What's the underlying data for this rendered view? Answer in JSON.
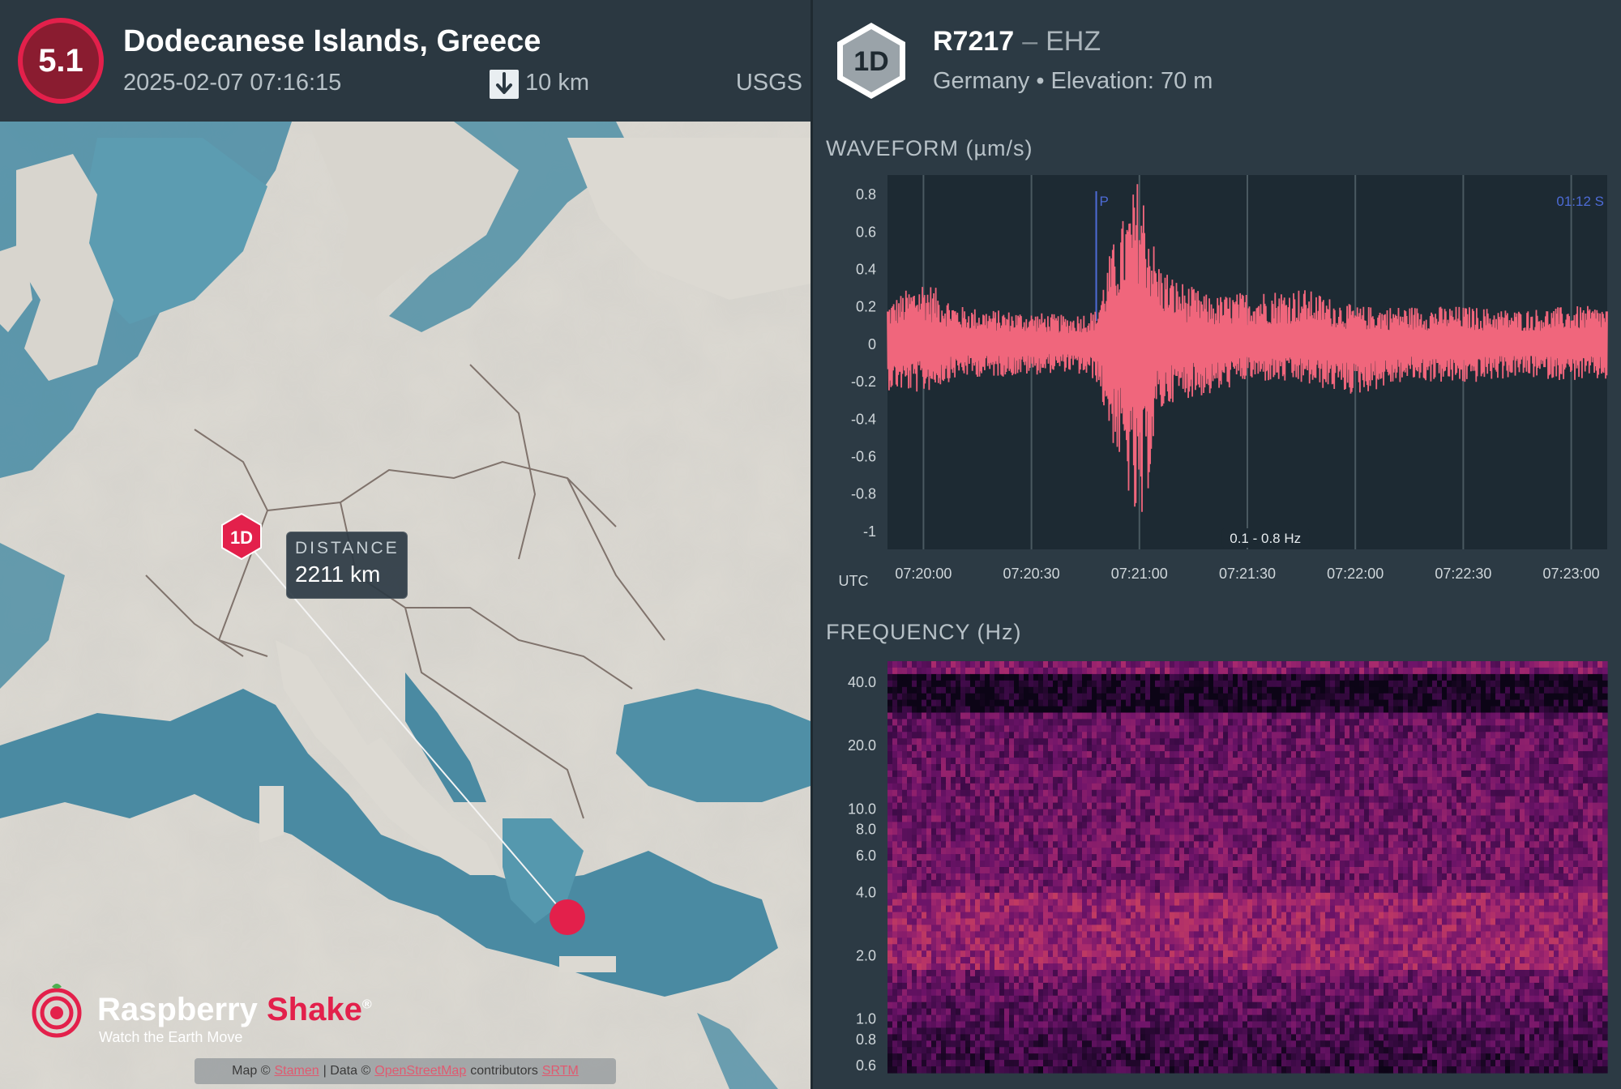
{
  "event": {
    "magnitude": "5.1",
    "title": "Dodecanese Islands, Greece",
    "datetime": "2025-02-07 07:16:15",
    "depth": "10 km",
    "source": "USGS",
    "depth_icon": "arrow-down-icon"
  },
  "map": {
    "station_marker": "1D",
    "distance_label": "DISTANCE",
    "distance_value": "2211 km",
    "logo": {
      "name_a": "Raspberry",
      "name_b": "Shake",
      "reg": "®",
      "tagline": "Watch the Earth Move"
    },
    "attribution": {
      "map_prefix": "Map ©",
      "map_link": "Stamen",
      "sep": "| Data ©",
      "data_link": "OpenStreetMap",
      "contributors": "contributors",
      "srtm": "SRTM"
    },
    "colors": {
      "sea": "#4f8fa6",
      "land": "#d9d6cf",
      "accent": "#e3204b"
    }
  },
  "station": {
    "badge": "1D",
    "id": "R7217",
    "separator": "–",
    "channel": "EHZ",
    "info": "Germany • Elevation: 70 m"
  },
  "waveform": {
    "title": "WAVEFORM (µm/s)",
    "y_ticks": [
      "0.8",
      "0.6",
      "0.4",
      "0.2",
      "0",
      "-0.2",
      "-0.4",
      "-0.6",
      "-0.8",
      "-1"
    ],
    "x_ticks": [
      "07:20:00",
      "07:20:30",
      "07:21:00",
      "07:21:30",
      "07:22:00",
      "07:22:30",
      "07:23:00"
    ],
    "x_unit": "UTC",
    "p_label": "P",
    "s_label": "01:12  S",
    "filter_label": "0.1 - 0.8 Hz",
    "color": "#f0667c"
  },
  "spectrogram": {
    "title": "FREQUENCY (Hz)",
    "y_ticks": [
      "40.0",
      "20.0",
      "10.0",
      "8.0",
      "6.0",
      "4.0",
      "2.0",
      "1.0",
      "0.8",
      "0.6"
    ]
  },
  "chart_data": [
    {
      "type": "line",
      "title": "WAVEFORM (µm/s)",
      "xlabel": "UTC",
      "ylabel": "",
      "ylim": [
        -1.1,
        0.9
      ],
      "x_ticks": [
        "07:20:00",
        "07:20:30",
        "07:21:00",
        "07:21:30",
        "07:22:00",
        "07:22:30",
        "07:23:00"
      ],
      "series": [
        {
          "name": "",
          "x": [
            "07:19:50",
            "07:20:00",
            "07:20:10",
            "07:20:20",
            "07:20:30",
            "07:20:40",
            "07:20:48",
            "07:20:52",
            "07:20:56",
            "07:20:58",
            "07:21:00",
            "07:21:02",
            "07:21:05",
            "07:21:10",
            "07:21:20",
            "07:21:30",
            "07:21:45",
            "07:22:00",
            "07:22:15",
            "07:22:30",
            "07:22:45",
            "07:23:00",
            "07:23:10"
          ],
          "min": [
            -0.25,
            -0.27,
            -0.18,
            -0.18,
            -0.17,
            -0.15,
            -0.2,
            -0.5,
            -0.75,
            -0.9,
            -1.15,
            -0.85,
            -0.4,
            -0.3,
            -0.28,
            -0.2,
            -0.22,
            -0.28,
            -0.2,
            -0.22,
            -0.18,
            -0.2,
            -0.2
          ],
          "max": [
            0.22,
            0.35,
            0.2,
            0.18,
            0.17,
            0.15,
            0.18,
            0.5,
            0.7,
            0.8,
            0.92,
            0.75,
            0.45,
            0.35,
            0.25,
            0.28,
            0.3,
            0.2,
            0.2,
            0.2,
            0.18,
            0.2,
            0.2
          ]
        }
      ],
      "annotations": [
        "P",
        "01:12  S",
        "0.1 - 0.8 Hz"
      ]
    },
    {
      "type": "heatmap",
      "title": "FREQUENCY (Hz)",
      "y_ticks": [
        "40.0",
        "20.0",
        "10.0",
        "8.0",
        "6.0",
        "4.0",
        "2.0",
        "1.0",
        "0.8",
        "0.6"
      ],
      "ylim": [
        0.55,
        50
      ]
    }
  ]
}
